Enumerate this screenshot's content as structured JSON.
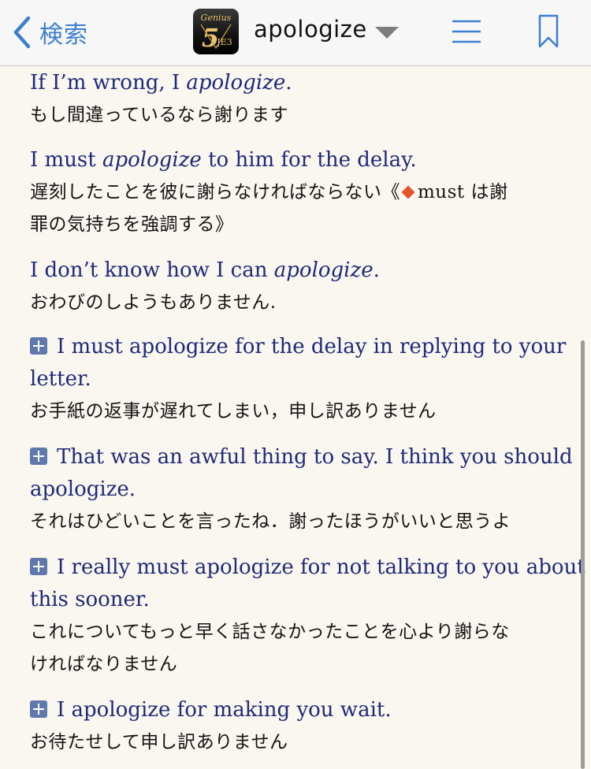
{
  "header": {
    "back_label": "検索",
    "word": "apologize",
    "app_icon": {
      "top_text": "Genius",
      "number": "5",
      "sub": "JE3"
    }
  },
  "icons": [
    "chevron-left-icon",
    "caret-down-icon",
    "hamburger-menu-icon",
    "bookmark-icon",
    "plus-box-icon",
    "diamond-marker-icon"
  ],
  "colors": {
    "english": "#1f2a78",
    "japanese": "#141414",
    "link": "#3d7fcf",
    "plus_box": "#5f79ad",
    "marker": "#e2552a",
    "background": "#faf6f0"
  },
  "examples": [
    {
      "en_pre": "If I’m wrong, I ",
      "en_em": "apologize",
      "en_post": ".",
      "ja": "もし間違っているなら謝ります"
    },
    {
      "en_pre": "I must ",
      "en_em": "apologize",
      "en_post": " to him for the delay.",
      "ja_line1": "遅刻したことを彼に謝らなければならない《",
      "ja_note_en": "must",
      "ja_line1_post": " は謝",
      "ja_line2": "罪の気持ちを強調する》"
    },
    {
      "en_pre": "I don’t know how I can ",
      "en_em": "apologize",
      "en_post": ".",
      "ja": "おわびのしようもありません."
    },
    {
      "en_line1": "I must apologize for the delay in replying to your",
      "en_line2": "letter.",
      "ja": "お手紙の返事が遅れてしまい，申し訳ありません"
    },
    {
      "en_line1": "That was an awful thing to say. I think you should",
      "en_line2": "apologize.",
      "ja": "それはひどいことを言ったね．謝ったほうがいいと思うよ"
    },
    {
      "en_line1": "I really must apologize for not talking to you about",
      "en_line2": "this sooner.",
      "ja_line1": "これについてもっと早く話さなかったことを心より謝らな",
      "ja_line2": "ければなりません"
    },
    {
      "en_line1": "I apologize for making you wait.",
      "ja": "お待たせして申し訳ありません"
    }
  ]
}
